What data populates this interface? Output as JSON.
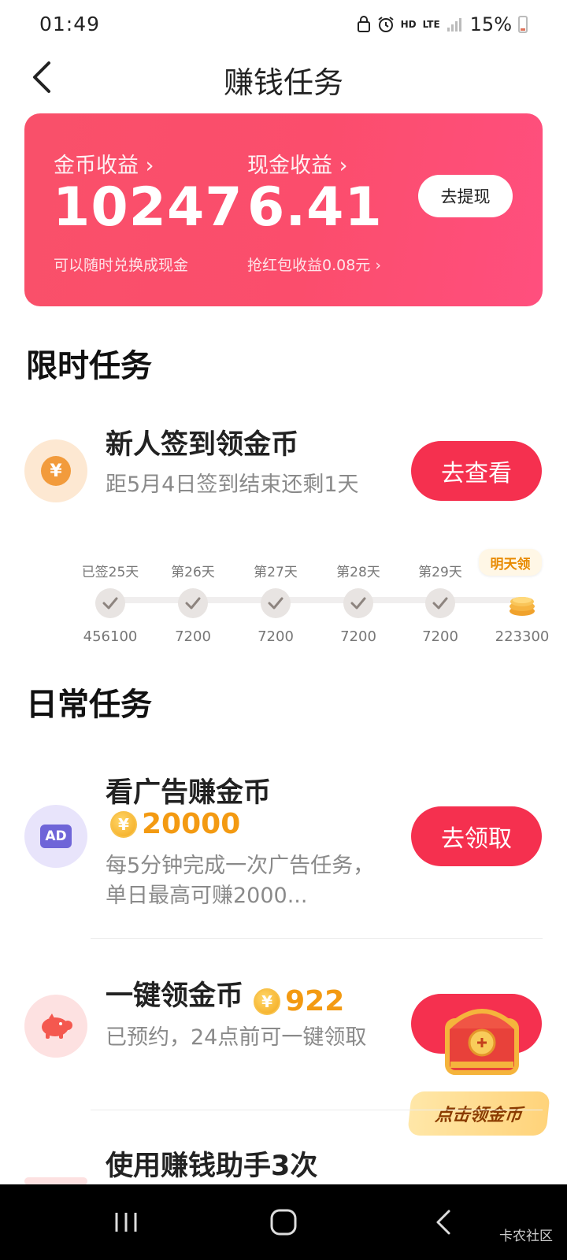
{
  "status_bar": {
    "time": "01:49",
    "network": "HD",
    "lte": "LTE",
    "battery": "15%"
  },
  "header": {
    "title": "赚钱任务"
  },
  "earnings": {
    "coin_label": "金币收益",
    "coin_value": "10247",
    "coin_sub": "可以随时兑换成现金",
    "cash_label": "现金收益",
    "cash_value": "6.41",
    "cash_sub": "抢红包收益0.08元",
    "withdraw_button": "去提现"
  },
  "limited_section": {
    "title": "限时任务",
    "task": {
      "title": "新人签到领金币",
      "desc": "距5月4日签到结束还剩1天",
      "button": "去查看"
    },
    "days": [
      {
        "label": "已签25天",
        "amount": "456100",
        "done": true
      },
      {
        "label": "第26天",
        "amount": "7200",
        "done": true
      },
      {
        "label": "第27天",
        "amount": "7200",
        "done": true
      },
      {
        "label": "第28天",
        "amount": "7200",
        "done": true
      },
      {
        "label": "第29天",
        "amount": "7200",
        "done": true
      },
      {
        "label": "明天领",
        "amount": "223300",
        "done": false
      }
    ]
  },
  "daily_section": {
    "title": "日常任务",
    "tasks": [
      {
        "icon": "ad-icon",
        "title": "看广告赚金币",
        "coin_amount": "20000",
        "desc": "每5分钟完成一次广告任务，单日最高可赚2000...",
        "button": "去领取"
      },
      {
        "icon": "piggy-bank-icon",
        "title": "一键领金币",
        "coin_amount": "922",
        "desc": "已预约，24点前可一键领取",
        "button": "点击领金币"
      },
      {
        "icon": "helper-icon",
        "title": "使用赚钱助手3次"
      }
    ]
  },
  "watermark": "卡农社区",
  "colors": {
    "accent": "#f5304f",
    "coin": "#f39a12",
    "card_start": "#f9506a",
    "card_end": "#ff4f7e"
  }
}
